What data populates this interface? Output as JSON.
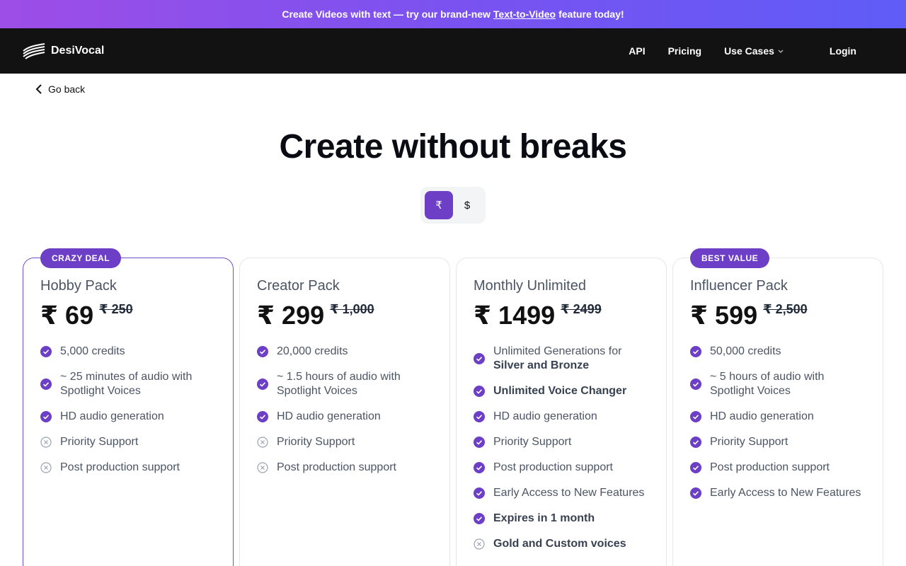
{
  "banner": {
    "before": "Create Videos with text — try our brand-new",
    "link": "Text-to-Video",
    "after": "feature today!"
  },
  "nav": {
    "brand": "DesiVocal",
    "links": [
      "API",
      "Pricing",
      "Use Cases"
    ],
    "login": "Login"
  },
  "goback": "Go back",
  "title": "Create without breaks",
  "currency": {
    "options": [
      "₹",
      "$"
    ],
    "selected": "₹"
  },
  "colors": {
    "accent": "#6d3fc7",
    "nav_bg": "#121212"
  },
  "plans": [
    {
      "name": "Hobby Pack",
      "badge": "CRAZY DEAL",
      "price": "₹ 69",
      "old_price": "₹ 250",
      "features": [
        {
          "text": "5,000 credits",
          "included": true
        },
        {
          "text": "~ 25 minutes of audio with Spotlight Voices",
          "included": true
        },
        {
          "text": "HD audio generation",
          "included": true
        },
        {
          "text": "Priority Support",
          "included": false
        },
        {
          "text": "Post production support",
          "included": false
        }
      ]
    },
    {
      "name": "Creator Pack",
      "badge": "",
      "price": "₹ 299",
      "old_price": "₹ 1,000",
      "features": [
        {
          "text": "20,000 credits",
          "included": true
        },
        {
          "text": "~ 1.5 hours of audio with Spotlight Voices",
          "included": true
        },
        {
          "text": "HD audio generation",
          "included": true
        },
        {
          "text": "Priority Support",
          "included": false
        },
        {
          "text": "Post production support",
          "included": false
        }
      ]
    },
    {
      "name": "Monthly Unlimited",
      "badge": "",
      "price": "₹ 1499",
      "old_price": "₹ 2499",
      "features": [
        {
          "text": "Unlimited Generations for",
          "strong": "Silver and Bronze",
          "included": true
        },
        {
          "text": "Unlimited Voice Changer",
          "included": true,
          "bold": true
        },
        {
          "text": "HD audio generation",
          "included": true
        },
        {
          "text": "Priority Support",
          "included": true
        },
        {
          "text": "Post production support",
          "included": true
        },
        {
          "text": "Early Access to New Features",
          "included": true
        },
        {
          "text": "Expires in 1 month",
          "included": true,
          "bold": true
        },
        {
          "text": "Gold and Custom voices",
          "included": false,
          "bold": true
        }
      ]
    },
    {
      "name": "Influencer Pack",
      "badge": "BEST VALUE",
      "price": "₹ 599",
      "old_price": "₹ 2,500",
      "features": [
        {
          "text": "50,000 credits",
          "included": true
        },
        {
          "text": "~ 5 hours of audio with Spotlight Voices",
          "included": true
        },
        {
          "text": "HD audio generation",
          "included": true
        },
        {
          "text": "Priority Support",
          "included": true
        },
        {
          "text": "Post production support",
          "included": true
        },
        {
          "text": "Early Access to New Features",
          "included": true
        }
      ]
    }
  ]
}
